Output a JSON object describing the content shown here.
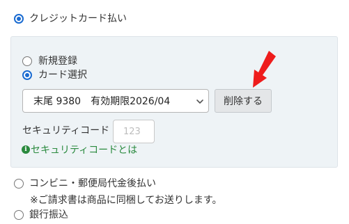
{
  "payment": {
    "credit_card_label": "クレジットカード払い",
    "card_panel": {
      "new_registration_label": "新規登録",
      "card_select_label": "カード選択",
      "selected_card": "末尾 9380　有効期限2026/04",
      "delete_button_label": "削除する",
      "security_code_label": "セキュリティコード",
      "security_code_placeholder": "123",
      "security_code_help_link": "セキュリティコードとは"
    },
    "convenience_label": "コンビニ・郵便局代金後払い",
    "convenience_note": "※ご請求書は商品に同梱してお送りします。",
    "bank_transfer_label": "銀行振込"
  },
  "colors": {
    "radio_checked": "#1a6bd1",
    "panel_background": "#eef3f6",
    "help_link": "#2a8a3e",
    "annotation_arrow": "#ee1c1c"
  },
  "icons": {
    "dropdown": "chevron-down-icon",
    "help": "info-icon",
    "annotation": "red-arrow-icon"
  }
}
